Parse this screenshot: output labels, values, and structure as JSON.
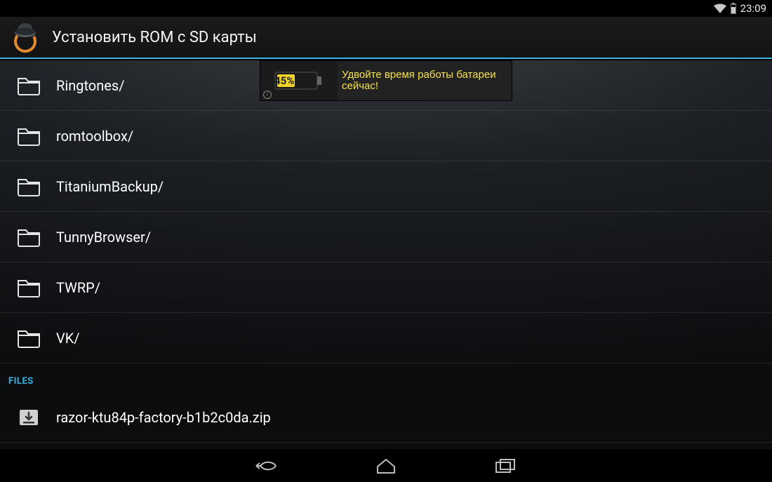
{
  "status": {
    "time": "23:09"
  },
  "appbar": {
    "title": "Установить ROM с SD карты"
  },
  "folders": [
    {
      "name": "Ringtones/"
    },
    {
      "name": "romtoolbox/"
    },
    {
      "name": "TitaniumBackup/"
    },
    {
      "name": "TunnyBrowser/"
    },
    {
      "name": "TWRP/"
    },
    {
      "name": "VK/"
    }
  ],
  "files_header": "FILES",
  "files": [
    {
      "name": "razor-ktu84p-factory-b1b2c0da.zip"
    }
  ],
  "ad": {
    "percent": "45%",
    "text": "Удвойте время работы батареи сейчас!"
  }
}
